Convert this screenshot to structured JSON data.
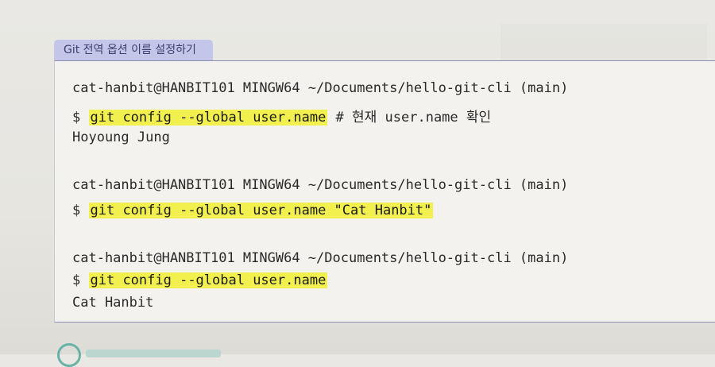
{
  "tab_label": "Git 전역 옵션 이름 설정하기",
  "blocks": [
    {
      "prompt": "cat-hanbit@HANBIT101 MINGW64 ~/Documents/hello-git-cli (main)",
      "dollar": "$",
      "command": "git config --global user.name",
      "comment": " # 현재 user.name 확인",
      "output": "Hoyoung Jung"
    },
    {
      "prompt": "cat-hanbit@HANBIT101 MINGW64 ~/Documents/hello-git-cli (main)",
      "dollar": "$",
      "command": "git config --global user.name \"Cat Hanbit\"",
      "comment": "",
      "output": ""
    },
    {
      "prompt": "cat-hanbit@HANBIT101 MINGW64 ~/Documents/hello-git-cli (main)",
      "dollar": "$",
      "command": "git config --global user.name",
      "comment": "",
      "output": "Cat Hanbit"
    }
  ],
  "colors": {
    "highlight": "#f2f04e",
    "tab_bg": "#c3c6e8",
    "tab_text": "#3b3f6e",
    "box_bg": "#f3f2ee"
  }
}
